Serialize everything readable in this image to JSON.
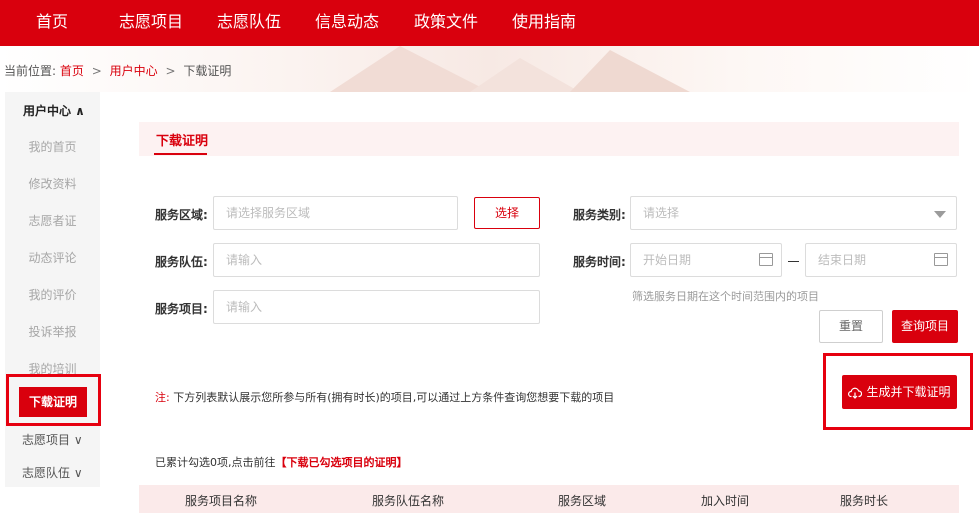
{
  "nav": {
    "items": [
      "首页",
      "志愿项目",
      "志愿队伍",
      "信息动态",
      "政策文件",
      "使用指南"
    ]
  },
  "breadcrumb": {
    "prefix": "当前位置:",
    "home": "首页",
    "sep1": ">",
    "user_center": "用户中心",
    "sep2": ">",
    "current": "下载证明"
  },
  "sidebar": {
    "header": "用户中心 ∧",
    "items": [
      "我的首页",
      "修改资料",
      "志愿者证",
      "动态评论",
      "我的评价",
      "投诉举报",
      "我的培训"
    ],
    "active": "下载证明",
    "groups": [
      "志愿项目 ∨",
      "志愿队伍 ∨"
    ]
  },
  "page": {
    "title": "下载证明"
  },
  "form": {
    "area_label": "服务区域:",
    "area_placeholder": "请选择服务区域",
    "select_button": "选择",
    "category_label": "服务类别:",
    "category_placeholder": "请选择",
    "team_label": "服务队伍:",
    "team_placeholder": "请输入",
    "time_label": "服务时间:",
    "start_placeholder": "开始日期",
    "end_placeholder": "结束日期",
    "project_label": "服务项目:",
    "project_placeholder": "请输入",
    "date_hint": "筛选服务日期在这个时间范围内的项目",
    "reset_button": "重置",
    "query_button": "查询项目",
    "download_button": "生成并下载证明"
  },
  "note": {
    "prefix": "注:",
    "text": "下方列表默认展示您所参与所有(拥有时长)的项目,可以通过上方条件查询您想要下载的项目"
  },
  "selection": {
    "count_text": "已累计勾选0项,点击前往",
    "link_text": "【下载已勾选项目的证明】"
  },
  "table": {
    "headers": [
      "服务项目名称",
      "服务队伍名称",
      "服务区域",
      "加入时间",
      "服务时长"
    ]
  },
  "colors": {
    "brand_red": "#d9000d",
    "highlight_red": "#e6000f"
  }
}
